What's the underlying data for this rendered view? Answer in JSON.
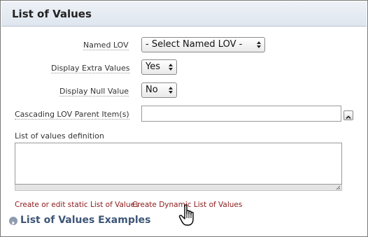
{
  "panel": {
    "title": "List of Values"
  },
  "fields": {
    "named_lov": {
      "label": "Named LOV",
      "value": "- Select Named LOV -"
    },
    "display_extra": {
      "label": "Display Extra Values",
      "value": "Yes"
    },
    "display_null": {
      "label": "Display Null Value",
      "value": "No"
    },
    "cascading_parent": {
      "label": "Cascading LOV Parent Item(s)",
      "value": ""
    },
    "lov_definition": {
      "label": "List of values definition",
      "value": ""
    }
  },
  "links": {
    "static": "Create or edit static List of Values",
    "dynamic": "Create Dynamic List of Values"
  },
  "examples": {
    "label": "List of Values Examples"
  },
  "icons": {
    "select_arrows": "updown-arrows-icon",
    "expand": "chevron-up-icon",
    "examples_toggle": "expand-circle-icon",
    "cursor": "hand-pointer-cursor"
  },
  "colors": {
    "link": "#8b1a1a",
    "examples_heading": "#3e5678",
    "header_bg": "#dfe6ef"
  }
}
